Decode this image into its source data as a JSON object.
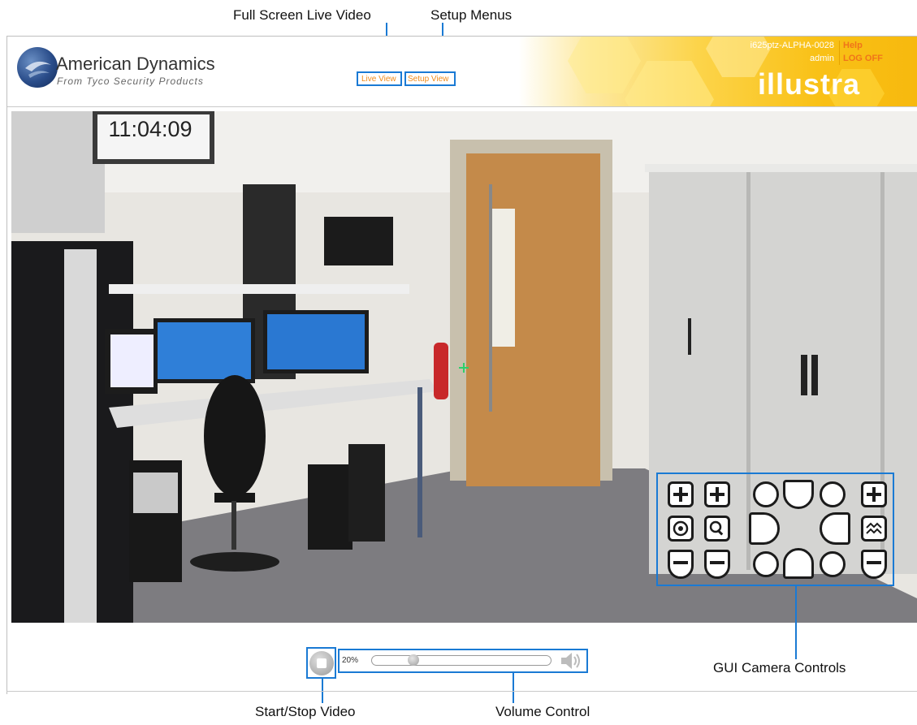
{
  "annotations": {
    "full_screen_live_video": "Full Screen Live Video",
    "setup_menus": "Setup Menus",
    "gui_camera_controls": "GUI Camera Controls",
    "start_stop_video": "Start/Stop Video",
    "volume_control": "Volume Control"
  },
  "header": {
    "brand_name": "American Dynamics",
    "brand_tagline": "From Tyco Security Products",
    "nav": {
      "live_view": "Live View",
      "setup_view": "Setup View"
    },
    "camera_name": "i625ptz-ALPHA-0028",
    "user": "admin",
    "help": "Help",
    "logoff": "LOG OFF",
    "product_logo": "illustra"
  },
  "video": {
    "timestamp": "11:04:09"
  },
  "controls": {
    "volume_level": "20%",
    "volume_fraction": 0.2
  },
  "ptz_icons": {
    "row1": [
      "zoom-in-icon",
      "focus-in-icon",
      "circle-icon",
      "tilt-up-icon",
      "circle-icon",
      "iris-open-icon"
    ],
    "row2": [
      "ring-icon",
      "magnifier-icon",
      "pan-left-icon",
      "pan-right-icon",
      "wave-icon"
    ],
    "row3": [
      "zoom-out-icon",
      "focus-out-icon",
      "circle-icon",
      "tilt-down-icon",
      "circle-icon",
      "iris-close-icon"
    ]
  },
  "colors": {
    "accent_blue": "#1a7ad4",
    "link_orange": "#f08a18",
    "banner_yellow": "#f9c117"
  }
}
